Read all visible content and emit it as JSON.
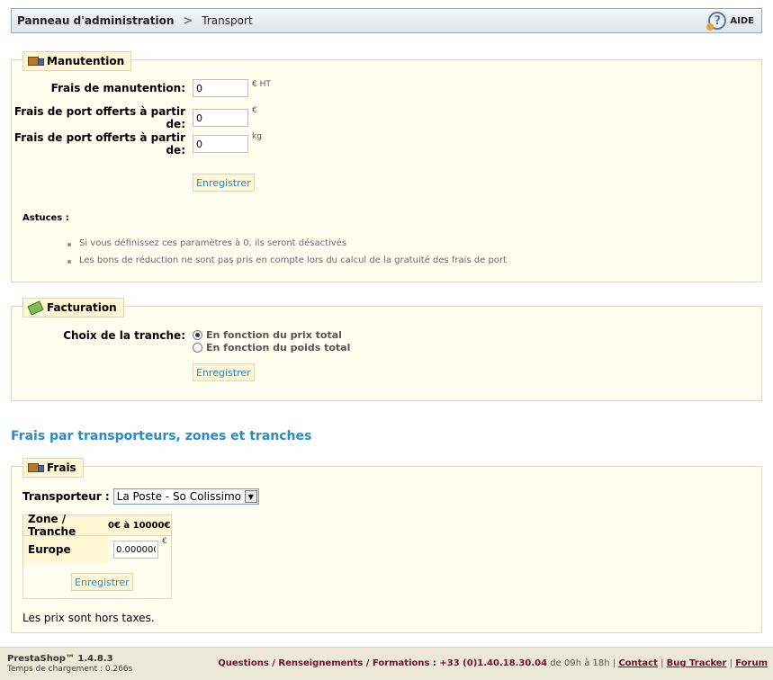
{
  "breadcrumb": {
    "home": "Panneau d'administration",
    "separator": ">",
    "current": "Transport",
    "help": "AIDE"
  },
  "handling": {
    "legend": "Manutention",
    "fields": [
      {
        "label": "Frais de manutention:",
        "value": "0",
        "unit": "€ HT"
      },
      {
        "label": "Frais de port offerts à partir de:",
        "value": "0",
        "unit": "€"
      },
      {
        "label": "Frais de port offerts à partir de:",
        "value": "0",
        "unit": "kg"
      }
    ],
    "save": "Enregistrer",
    "tips_title": "Astuces :",
    "tips": [
      "Si vous définissez ces paramètres à 0, ils seront désactivés",
      "Les bons de réduction ne sont pas pris en compte lors du calcul de la gratuité des frais de port"
    ]
  },
  "billing": {
    "legend": "Facturation",
    "label": "Choix de la tranche:",
    "options": [
      {
        "label": "En fonction du prix total",
        "checked": true
      },
      {
        "label": "En fonction du poids total",
        "checked": false
      }
    ],
    "save": "Enregistrer"
  },
  "fees_heading": "Frais par transporteurs, zones et tranches",
  "fees": {
    "legend": "Frais",
    "carrier_label": "Transporteur :",
    "carrier_value": "La Poste - So Colissimo",
    "table": {
      "col_zone": "Zone / Tranche",
      "col_range": "0€ à 10000€",
      "rows": [
        {
          "zone": "Europe",
          "value": "0.000000",
          "unit": "€"
        }
      ]
    },
    "save": "Enregistrer",
    "note": "Les prix sont hors taxes."
  },
  "footer": {
    "brand": "PrestaShop™ 1.4.8.3",
    "load_time": "Temps de chargement : 0.266s",
    "contact_text": "Questions / Renseignements / Formations : ",
    "phone": "+33 (0)1.40.18.30.04",
    "hours": " de 09h à 18h",
    "sep": "|",
    "links": [
      "Contact",
      "Bug Tracker",
      "Forum"
    ]
  }
}
